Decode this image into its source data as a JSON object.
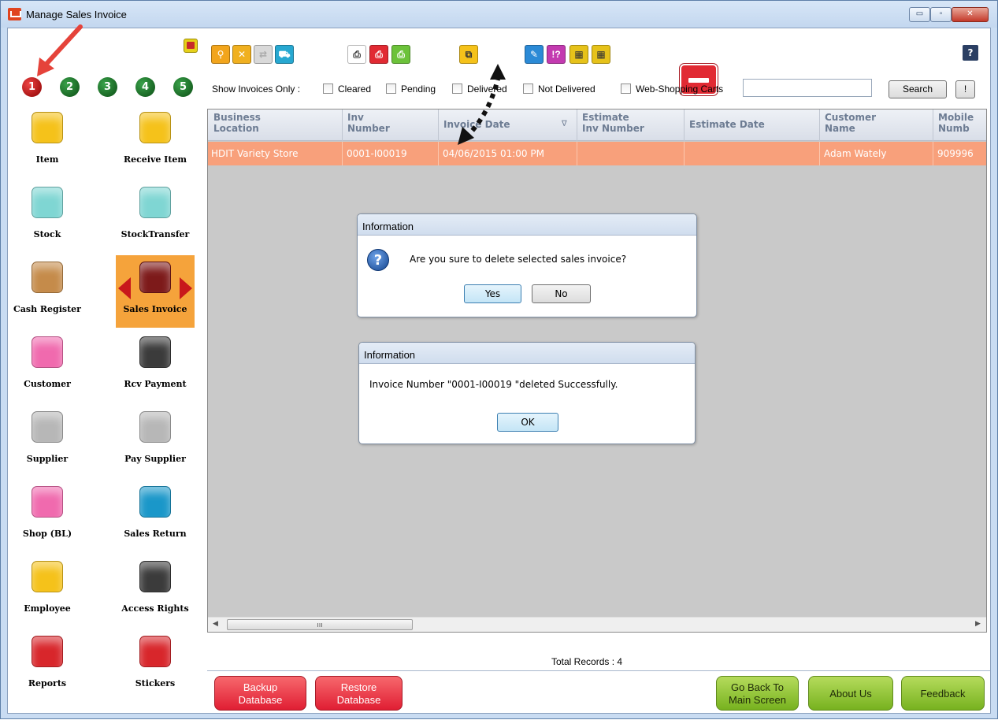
{
  "window": {
    "title": "Manage Sales Invoice",
    "buttons": {
      "minimize": "▭",
      "maximize": "▫",
      "close": "✕"
    }
  },
  "sidebar": {
    "steps": [
      "1",
      "2",
      "3",
      "4",
      "5"
    ],
    "tiles": [
      {
        "label": "Item",
        "icon": "shopping-cart-icon",
        "color": "#f5c21a"
      },
      {
        "label": "Receive Item",
        "icon": "truck-icon",
        "color": "#f5c21a"
      },
      {
        "label": "Stock",
        "icon": "hand-truck-icon",
        "color": "#7fd6d3"
      },
      {
        "label": "StockTransfer",
        "icon": "box-transfer-icon",
        "color": "#7fd6d3"
      },
      {
        "label": "Cash Register",
        "icon": "cash-register-icon",
        "color": "#c58b4a"
      },
      {
        "label": "Sales Invoice",
        "icon": "invoice-edit-icon",
        "color": "#7d1a1a"
      },
      {
        "label": "Customer",
        "icon": "people-icon",
        "color": "#f06aae"
      },
      {
        "label": "Rcv Payment",
        "icon": "money-bag-icon",
        "color": "#3b3b3b"
      },
      {
        "label": "Supplier",
        "icon": "factory-icon",
        "color": "#b7b7b7"
      },
      {
        "label": "Pay Supplier",
        "icon": "factory-arrow-icon",
        "color": "#b7b7b7"
      },
      {
        "label": "Shop (BL)",
        "icon": "shop-icon",
        "color": "#f06aae"
      },
      {
        "label": "Sales Return",
        "icon": "cart-return-icon",
        "color": "#1a97c9"
      },
      {
        "label": "Employee",
        "icon": "person-icon",
        "color": "#f5c21a"
      },
      {
        "label": "Access Rights",
        "icon": "lock-key-icon",
        "color": "#3b3b3b"
      },
      {
        "label": "Reports",
        "icon": "scroll-icon",
        "color": "#d8262b"
      },
      {
        "label": "Stickers",
        "icon": "barcode-icon",
        "color": "#d8262b"
      }
    ]
  },
  "toolbar": {
    "help": "?"
  },
  "filters": {
    "label": "Show Invoices Only :",
    "options": [
      "Cleared",
      "Pending",
      "Delivered",
      "Not Delivered",
      "Web-Shopping Carts"
    ],
    "search_value": "",
    "search_button": "Search",
    "extra_button": "!"
  },
  "grid": {
    "columns": [
      [
        "Business",
        "Location"
      ],
      [
        "Inv",
        "Number"
      ],
      [
        "Invoice Date",
        ""
      ],
      [
        "Estimate",
        "Inv Number"
      ],
      [
        "Estimate Date",
        ""
      ],
      [
        "Customer",
        "Name"
      ],
      [
        "Mobile",
        "Numb"
      ]
    ],
    "rows": [
      [
        "HDIT Variety Store",
        "0001-I00019",
        "04/06/2015 01:00 PM",
        "",
        "",
        "Adam Wately",
        "909996"
      ]
    ],
    "total_label": "Total Records : 4"
  },
  "dialog_confirm": {
    "title": "Information",
    "message": "Are you sure to delete selected sales invoice?",
    "yes": "Yes",
    "no": "No"
  },
  "dialog_done": {
    "title": "Information",
    "message": "Invoice Number \"0001-I00019 \"deleted Successfully.",
    "ok": "OK"
  },
  "bottom_buttons": {
    "backup": [
      "Backup",
      "Database"
    ],
    "restore": [
      "Restore",
      "Database"
    ],
    "go_back": [
      "Go Back To",
      "Main Screen"
    ],
    "about": "About Us",
    "feedback": "Feedback"
  }
}
